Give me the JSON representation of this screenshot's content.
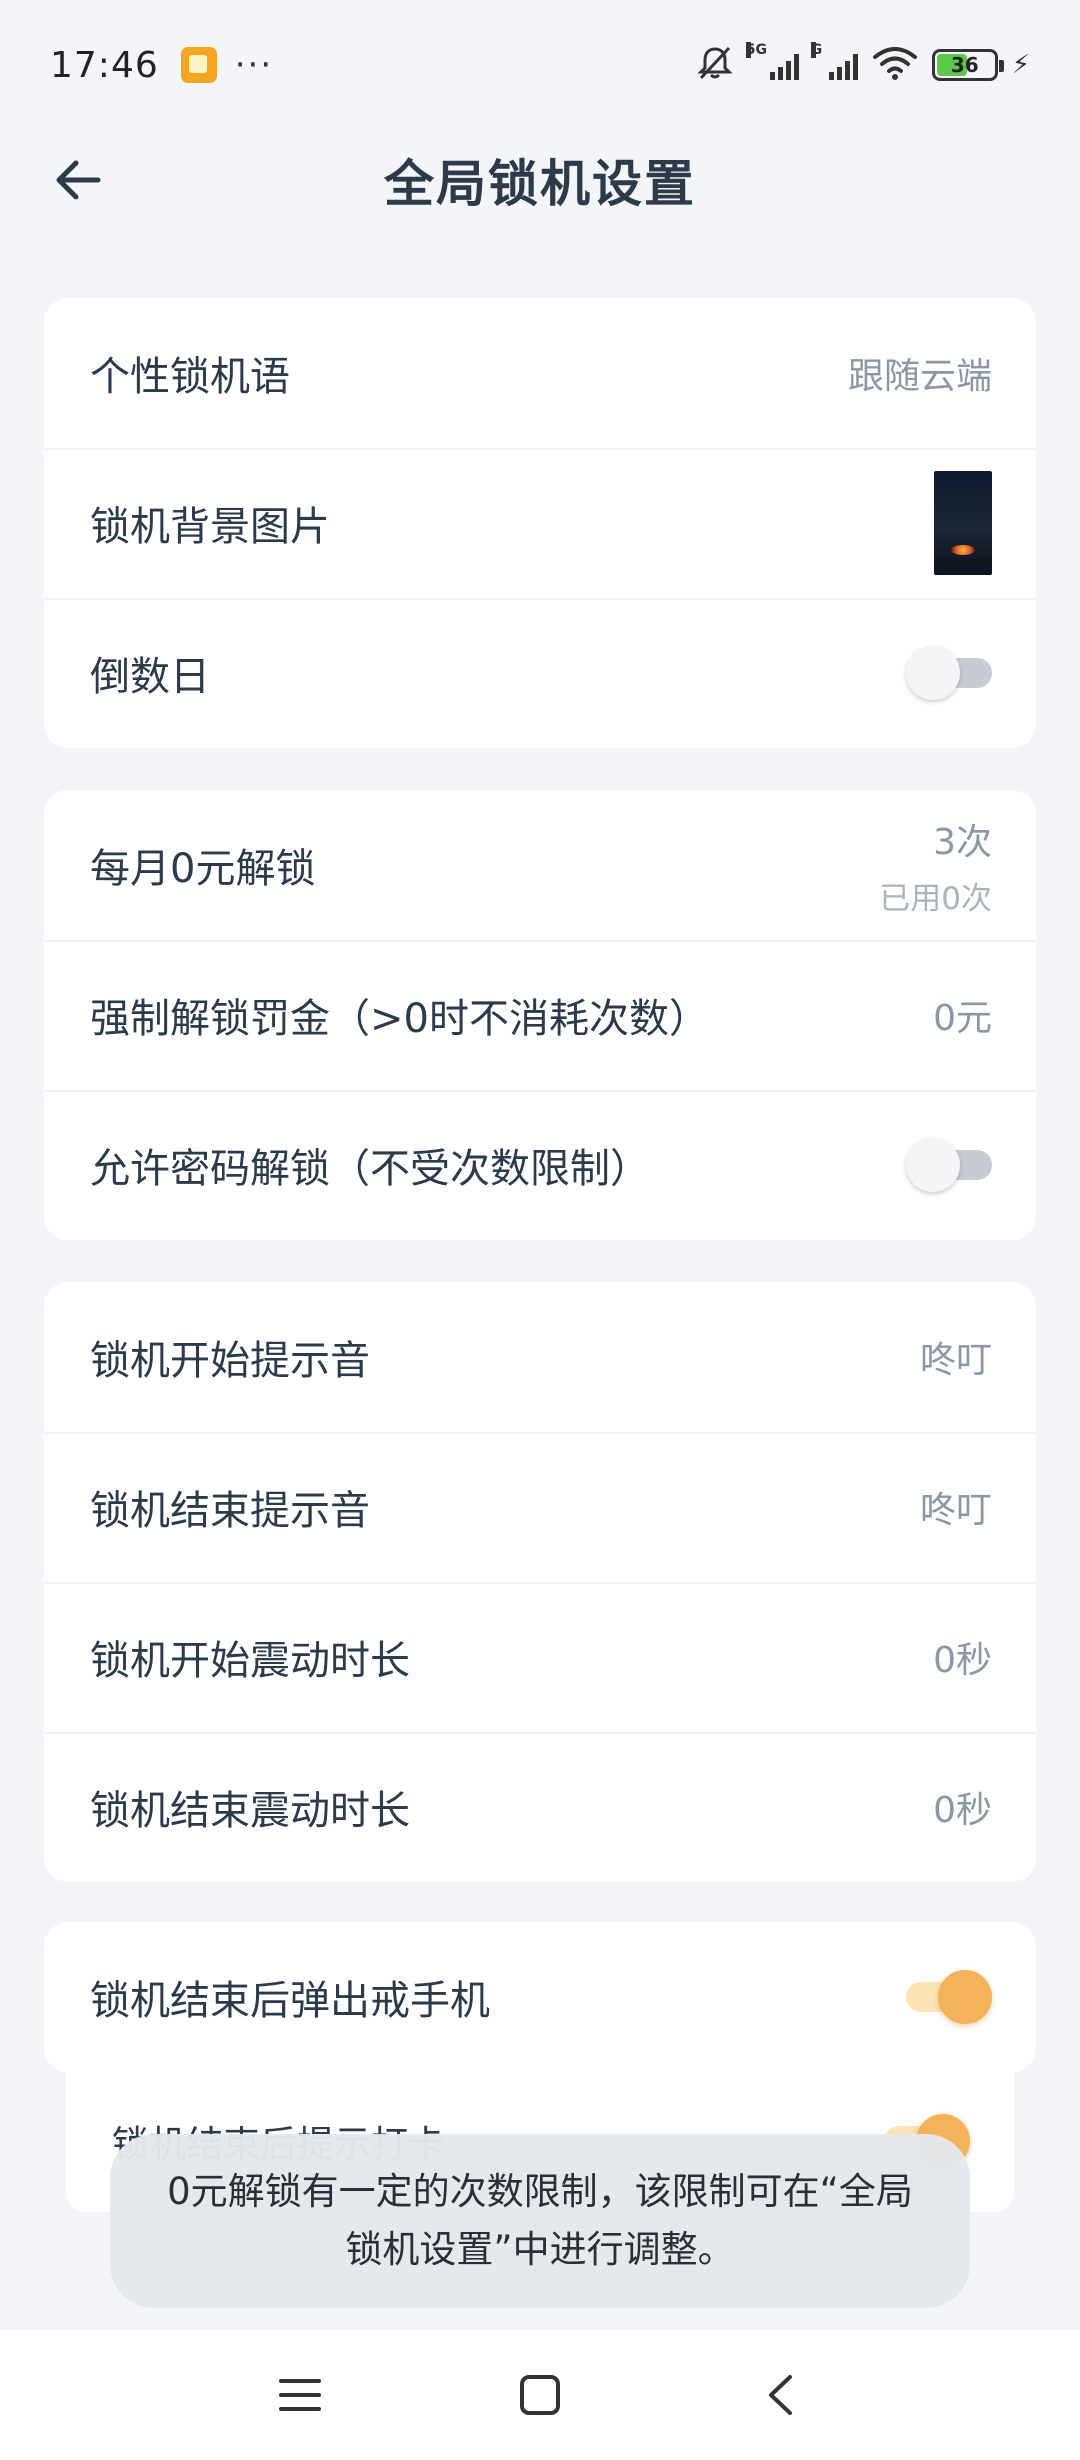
{
  "status": {
    "time": "17:46",
    "more": "···",
    "network_label": "5G",
    "network_label2": "G",
    "battery_level": "36"
  },
  "header": {
    "title": "全局锁机设置"
  },
  "groups": {
    "general": {
      "motto_label": "个性锁机语",
      "motto_value": "跟随云端",
      "bg_label": "锁机背景图片",
      "countdown_label": "倒数日"
    },
    "unlock": {
      "free_label": "每月0元解锁",
      "free_value": "3次",
      "free_used": "已用0次",
      "fine_label": "强制解锁罚金（>0时不消耗次数）",
      "fine_value": "0元",
      "password_label": "允许密码解锁（不受次数限制）"
    },
    "sound": {
      "start_tone_label": "锁机开始提示音",
      "start_tone_value": "咚叮",
      "end_tone_label": "锁机结束提示音",
      "end_tone_value": "咚叮",
      "start_vibe_label": "锁机开始震动时长",
      "start_vibe_value": "0秒",
      "end_vibe_label": "锁机结束震动时长",
      "end_vibe_value": "0秒"
    },
    "after": {
      "popup_label": "锁机结束后弹出戒手机",
      "checkin_label": "锁机结束后提示打卡"
    }
  },
  "toggles": {
    "countdown": false,
    "password_unlock": false,
    "popup": true,
    "checkin": true
  },
  "toast": {
    "text": "0元解锁有一定的次数限制，该限制可在“全局锁机设置”中进行调整。"
  },
  "colors": {
    "accent": "#f4b35b",
    "background": "#f3f5f8",
    "text": "#2d3a4a",
    "secondary": "#8c97a5"
  }
}
